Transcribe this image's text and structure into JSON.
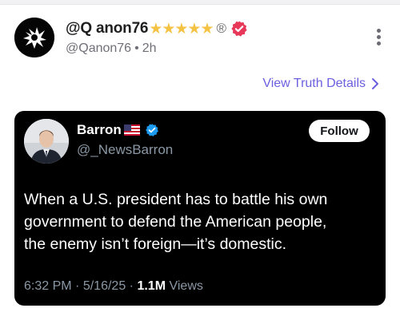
{
  "post": {
    "display_name": "@Q anon76",
    "stars": "★★★★★",
    "registered_mark": "®",
    "handle": "@Qanon76",
    "separator": "•",
    "time_ago": "2h",
    "view_details_label": "View Truth Details"
  },
  "embedded_tweet": {
    "name": "Barron",
    "flag": "US flag",
    "handle": "@_NewsBarron",
    "follow_label": "Follow",
    "text_lines": [
      "When a U.S. president has to battle his own",
      "government to defend the American people,",
      "the enemy isn’t foreign—it’s domestic."
    ],
    "time": "6:32 PM",
    "sep1": "·",
    "date": "5/16/25",
    "sep2": "·",
    "views_count": "1.1M",
    "views_label": "Views"
  },
  "colors": {
    "accent_link": "#6b5fe0",
    "star": "#f5c344",
    "verified_pink": "#e8385a",
    "verified_blue": "#1d9bf0",
    "card_bg": "#000000"
  },
  "icons": [
    "avatar-logo-icon",
    "verified-badge-icon",
    "more-options-icon",
    "chevron-right-icon",
    "us-flag-icon",
    "blue-verified-icon"
  ]
}
